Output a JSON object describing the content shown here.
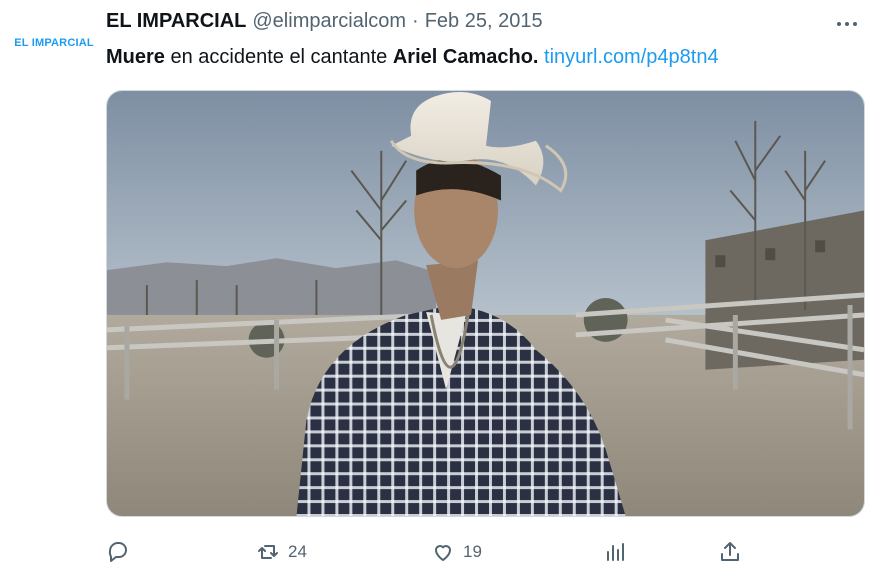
{
  "author": {
    "avatar_text": "EL IMPARCIAL",
    "display_name": "EL IMPARCIAL",
    "handle": "@elimparcialcom",
    "separator": "·",
    "date": "Feb 25, 2015"
  },
  "tweet": {
    "text_bold_1": "Muere",
    "text_1": " en accidente el cantante ",
    "text_bold_2": "Ariel Camacho.",
    "text_2": " ",
    "link": "tinyurl.com/p4p8tn4"
  },
  "actions": {
    "replies": "",
    "retweets": "24",
    "likes": "19",
    "views": ""
  },
  "colors": {
    "accent": "#1d9bf0",
    "muted": "#536471"
  },
  "icons": [
    "more-icon",
    "reply-icon",
    "retweet-icon",
    "like-icon",
    "views-icon",
    "share-icon"
  ]
}
